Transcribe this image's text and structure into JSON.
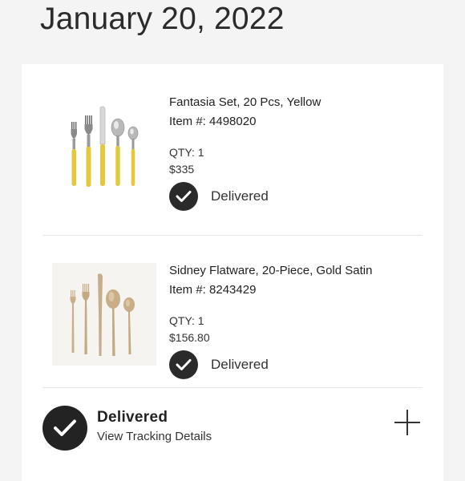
{
  "order": {
    "date": "January 20, 2022"
  },
  "items": [
    {
      "name": "Fantasia Set, 20 Pcs, Yellow",
      "item_number": "Item #: 4498020",
      "qty": "QTY: 1",
      "price": "$335",
      "status": "Delivered"
    },
    {
      "name": "Sidney Flatware, 20-Piece, Gold Satin",
      "item_number": "Item #: 8243429",
      "qty": "QTY: 1",
      "price": "$156.80",
      "status": "Delivered"
    }
  ],
  "footer": {
    "status": "Delivered",
    "link": "View Tracking Details",
    "icon": "plus-icon"
  },
  "colors": {
    "background": "#f4f4f4",
    "card": "#ffffff",
    "check_circle": "#2a2a2a",
    "yellow_handle": "#e4c93c",
    "gold": "#c9b08c"
  }
}
